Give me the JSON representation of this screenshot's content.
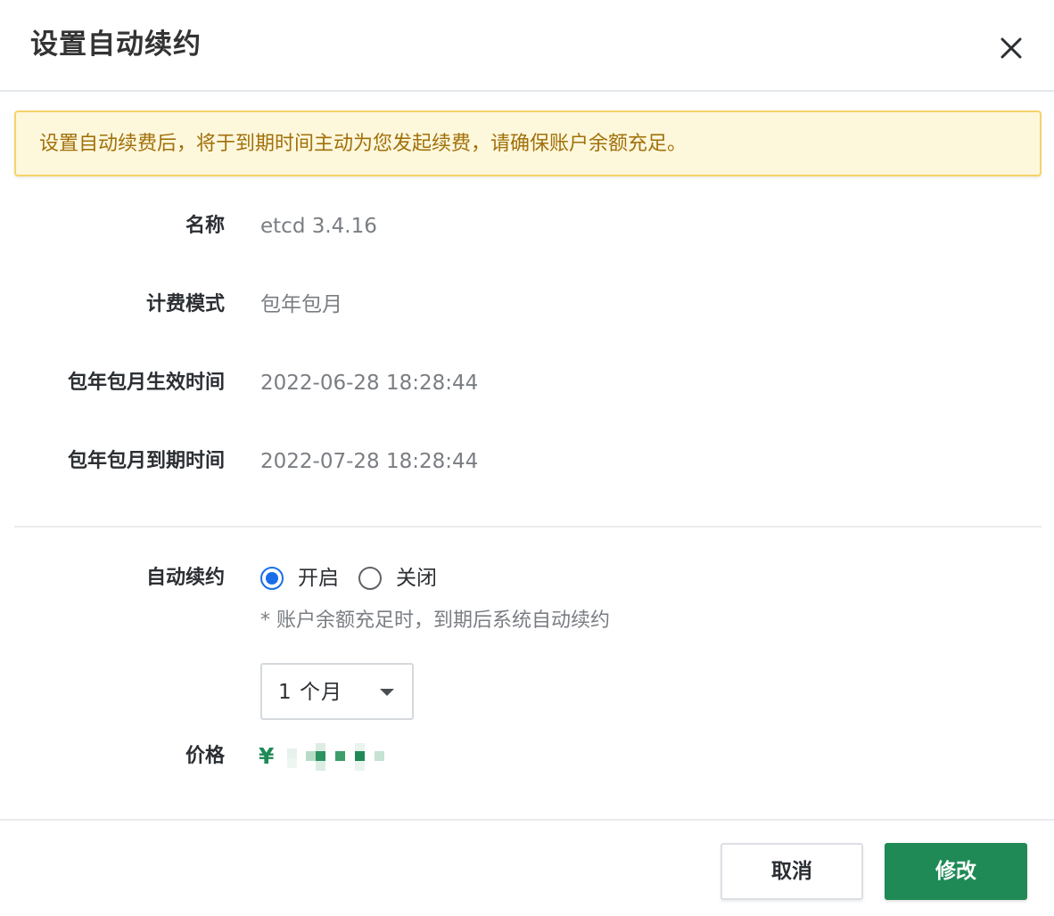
{
  "dialog": {
    "title": "设置自动续约",
    "close_icon": "close-icon"
  },
  "notice": {
    "text": "设置自动续费后，将于到期时间主动为您发起续费，请确保账户余额充足。"
  },
  "details": {
    "name_label": "名称",
    "name_value": "etcd 3.4.16",
    "billing_label": "计费模式",
    "billing_value": "包年包月",
    "effective_label": "包年包月生效时间",
    "effective_value": "2022-06-28 18:28:44",
    "expire_label": "包年包月到期时间",
    "expire_value": "2022-07-28 18:28:44"
  },
  "auto_renew": {
    "label": "自动续约",
    "option_on": "开启",
    "option_off": "关闭",
    "selected": "开启",
    "hint": "* 账户余额充足时，到期后系统自动续约",
    "duration_selected": "1  个月"
  },
  "price": {
    "label": "价格",
    "currency": "¥"
  },
  "footer": {
    "cancel_label": "取消",
    "confirm_label": "修改"
  },
  "colors": {
    "accent_green": "#1f8a55",
    "radio_blue": "#1a6fe8",
    "notice_bg": "#fdf7dc",
    "notice_border": "#f5d36a",
    "notice_text": "#a1700a"
  }
}
